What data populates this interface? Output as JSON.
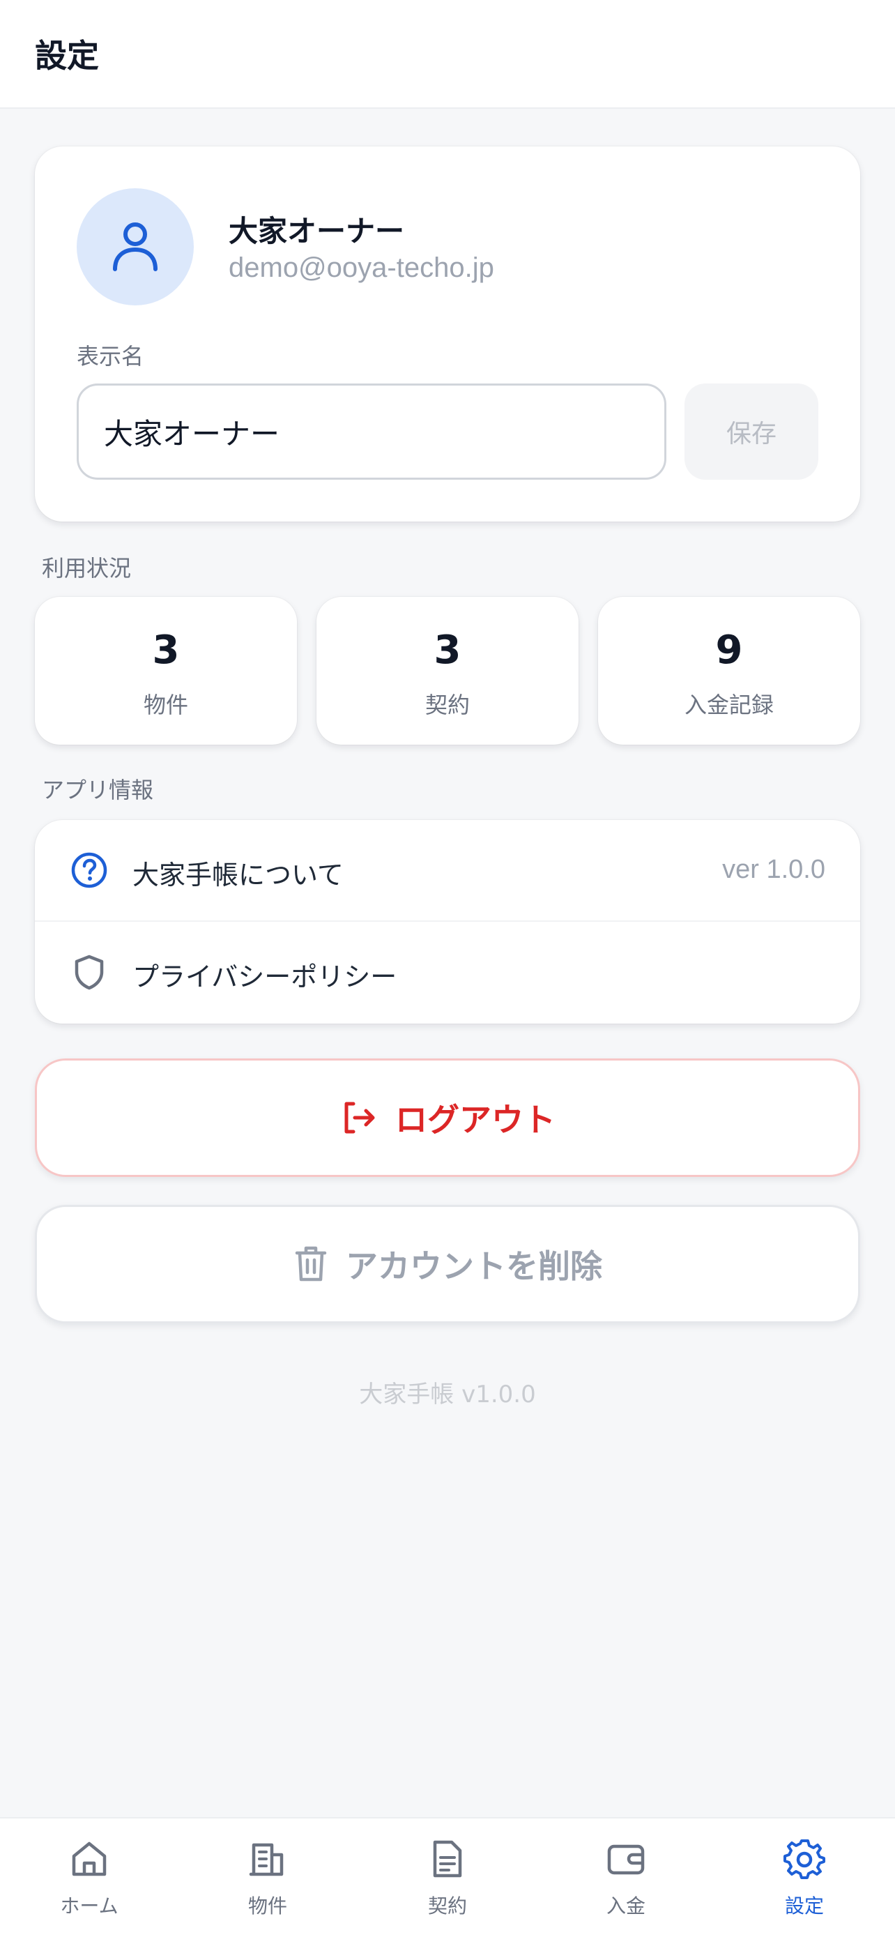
{
  "header": {
    "title": "設定"
  },
  "profile": {
    "name": "大家オーナー",
    "email": "demo@ooya-techo.jp",
    "display_name_label": "表示名",
    "display_name_value": "大家オーナー",
    "save_label": "保存",
    "avatar_icon": "user-icon"
  },
  "usage": {
    "section_label": "利用状況",
    "stats": [
      {
        "value": "3",
        "label": "物件"
      },
      {
        "value": "3",
        "label": "契約"
      },
      {
        "value": "9",
        "label": "入金記録"
      }
    ]
  },
  "app_info": {
    "section_label": "アプリ情報",
    "items": [
      {
        "label": "大家手帳について",
        "value": "ver 1.0.0",
        "icon": "question-circle-icon"
      },
      {
        "label": "プライバシーポリシー",
        "icon": "shield-icon"
      }
    ]
  },
  "actions": {
    "logout_label": "ログアウト",
    "delete_account_label": "アカウントを削除"
  },
  "footer": {
    "version": "大家手帳 v1.0.0"
  },
  "tabbar": {
    "items": [
      {
        "label": "ホーム",
        "icon": "home-icon"
      },
      {
        "label": "物件",
        "icon": "building-icon"
      },
      {
        "label": "契約",
        "icon": "document-icon"
      },
      {
        "label": "入金",
        "icon": "wallet-icon"
      },
      {
        "label": "設定",
        "icon": "gear-icon"
      }
    ],
    "active": "設定"
  },
  "colors": {
    "accent": "#1D5FD6",
    "danger": "#DC2626",
    "background": "#F6F7F9"
  }
}
